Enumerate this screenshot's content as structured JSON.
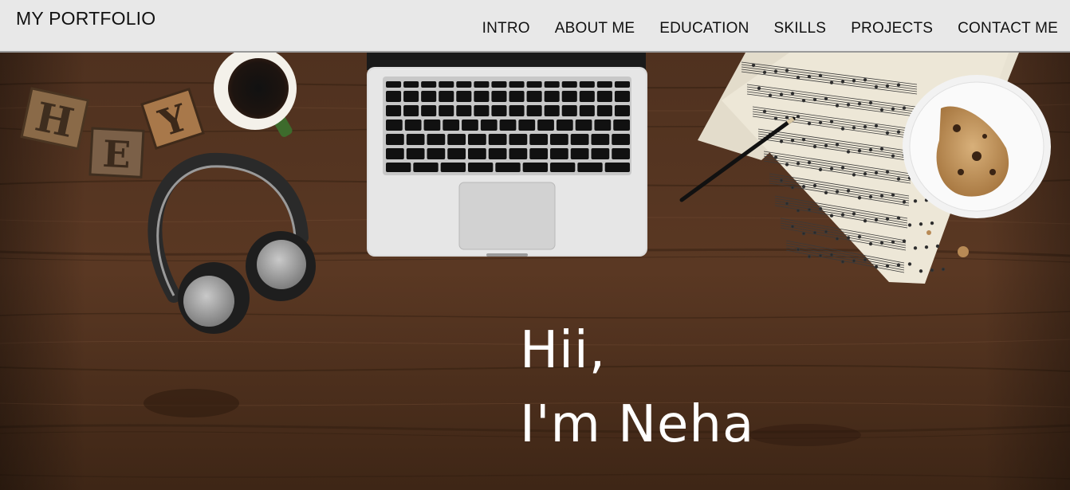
{
  "header": {
    "brand": "MY PORTFOLIO",
    "nav": [
      {
        "label": "INTRO"
      },
      {
        "label": "ABOUT ME"
      },
      {
        "label": "EDUCATION"
      },
      {
        "label": "SKILLS"
      },
      {
        "label": "PROJECTS"
      },
      {
        "label": "CONTACT ME"
      }
    ]
  },
  "hero": {
    "greeting": "Hii,",
    "intro": "I'm Neha",
    "photo_letters": [
      "H",
      "E",
      "Y"
    ]
  },
  "colors": {
    "navbar_bg": "#e8e8e8",
    "hero_text": "#ffffff",
    "wood": "#4a2e1c"
  }
}
